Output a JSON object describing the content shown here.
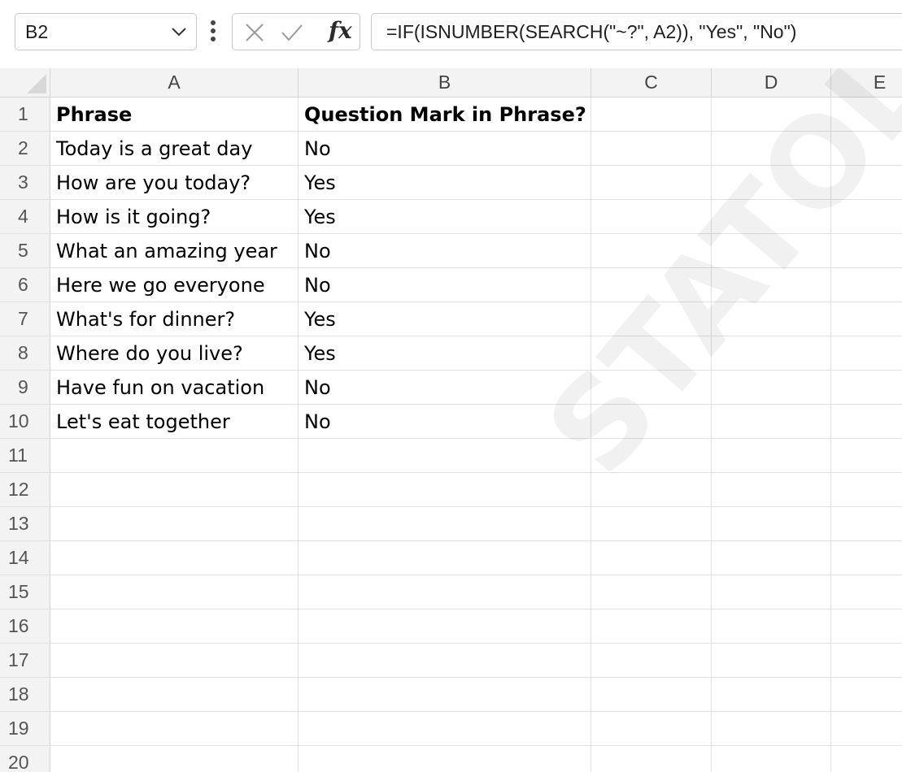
{
  "formula_bar": {
    "name_box": "B2",
    "dropdown_icon": "chevron-down-icon",
    "more_icon": "vertical-ellipsis-icon",
    "cancel_icon": "close-icon",
    "enter_icon": "checkmark-icon",
    "fx_label": "fx",
    "formula": "=IF(ISNUMBER(SEARCH(\"~?\", A2)), \"Yes\", \"No\")"
  },
  "grid": {
    "columns": [
      "A",
      "B",
      "C",
      "D",
      "E"
    ],
    "row_numbers": [
      "1",
      "2",
      "3",
      "4",
      "5",
      "6",
      "7",
      "8",
      "9",
      "10",
      "11",
      "12",
      "13",
      "14",
      "15",
      "16",
      "17",
      "18",
      "19",
      "20"
    ],
    "header_row": [
      "Phrase",
      "Question Mark in Phrase?"
    ],
    "data_rows": [
      [
        "Today is a great day",
        "No"
      ],
      [
        "How are you today?",
        "Yes"
      ],
      [
        "How is it going?",
        "Yes"
      ],
      [
        "What an amazing year",
        "No"
      ],
      [
        "Here we go everyone",
        "No"
      ],
      [
        "What's for dinner?",
        "Yes"
      ],
      [
        "Where do you live?",
        "Yes"
      ],
      [
        "Have fun on vacation",
        "No"
      ],
      [
        "Let's eat together",
        "No"
      ]
    ]
  },
  "watermark": "STATOLOGY.COM",
  "colors": {
    "header_bg": "#f3f3f3",
    "gridline": "#e1e1e1",
    "header_border": "#d4d4d4"
  }
}
